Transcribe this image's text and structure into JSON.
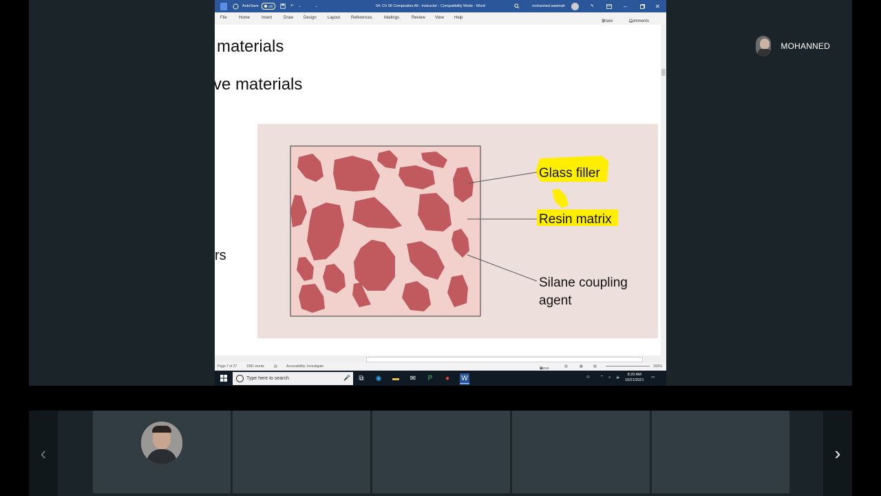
{
  "participant": {
    "name": "MOHANNED"
  },
  "word": {
    "titlebar": {
      "autosave_label": "AutoSave",
      "autosave_state": "Off",
      "doc_title": "04. Ch 06 Composites All - instructor  -  Compatibility Mode  -  Word",
      "user": "mohanned.sawmah"
    },
    "menu": {
      "items": [
        "File",
        "Home",
        "Insert",
        "Draw",
        "Design",
        "Layout",
        "References",
        "Mailings",
        "Review",
        "View",
        "Help"
      ],
      "share_label": "Share",
      "comments_label": "Comments"
    },
    "doc_lines": [
      "materials",
      "ve materials",
      "rs"
    ],
    "figure": {
      "labels": {
        "glass_filler": "Glass filler",
        "resin_matrix": "Resin matrix",
        "silane_line1": "Silane coupling",
        "silane_line2": "agent"
      },
      "colors": {
        "background": "#ecdfdc",
        "matrix": "#f2d0cc",
        "particle": "#c05a5e",
        "highlight": "#ffee00"
      }
    },
    "status": {
      "page": "Page 7 of 27",
      "words": "1581 words",
      "accessibility": "Accessibility: Investigate",
      "focus": "Focus",
      "zoom": "150%"
    }
  },
  "taskbar": {
    "search_placeholder": "Type here to search",
    "time": "8:20 AM",
    "date": "10/21/2021"
  },
  "strip": {
    "prev_glyph": "‹",
    "next_glyph": "›"
  }
}
